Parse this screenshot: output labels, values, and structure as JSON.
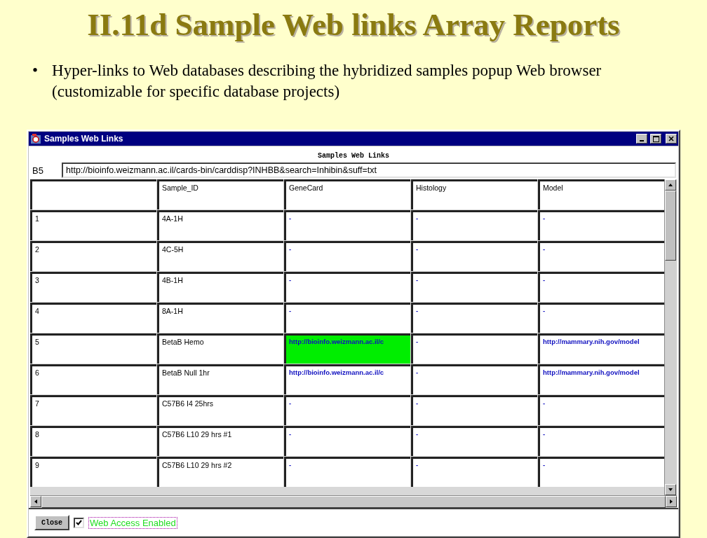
{
  "slide": {
    "title": "II.11d Sample Web links Array Reports",
    "bullets": [
      {
        "marker": "•",
        "text": "Hyper-links to Web databases describing the hybridized samples popup Web browser (customizable for specific database projects)"
      }
    ]
  },
  "window": {
    "title": "Samples Web Links",
    "caption": "Samples Web Links",
    "address": {
      "label": "B5",
      "value": "http://bioinfo.weizmann.ac.il/cards-bin/carddisp?INHBB&search=Inhibin&suff=txt"
    },
    "table": {
      "columns": [
        "",
        "Sample_ID",
        "GeneCard",
        "Histology",
        "Model"
      ],
      "rows": [
        {
          "cells": [
            {
              "kind": "plain",
              "text": "1",
              "selected": false
            },
            {
              "kind": "plain",
              "text": "4A-1H",
              "selected": false
            },
            {
              "kind": "link",
              "text": "-",
              "selected": false
            },
            {
              "kind": "link",
              "text": "-",
              "selected": false
            },
            {
              "kind": "link",
              "text": "-",
              "selected": false
            }
          ]
        },
        {
          "cells": [
            {
              "kind": "plain",
              "text": "2",
              "selected": false
            },
            {
              "kind": "plain",
              "text": "4C-5H",
              "selected": false
            },
            {
              "kind": "link",
              "text": "-",
              "selected": false
            },
            {
              "kind": "link",
              "text": "-",
              "selected": false
            },
            {
              "kind": "link",
              "text": "-",
              "selected": false
            }
          ]
        },
        {
          "cells": [
            {
              "kind": "plain",
              "text": "3",
              "selected": false
            },
            {
              "kind": "plain",
              "text": "4B-1H",
              "selected": false
            },
            {
              "kind": "link",
              "text": "-",
              "selected": false
            },
            {
              "kind": "link",
              "text": "-",
              "selected": false
            },
            {
              "kind": "link",
              "text": "-",
              "selected": false
            }
          ]
        },
        {
          "cells": [
            {
              "kind": "plain",
              "text": "4",
              "selected": false
            },
            {
              "kind": "plain",
              "text": "8A-1H",
              "selected": false
            },
            {
              "kind": "link",
              "text": "-",
              "selected": false
            },
            {
              "kind": "link",
              "text": "-",
              "selected": false
            },
            {
              "kind": "link",
              "text": "-",
              "selected": false
            }
          ]
        },
        {
          "cells": [
            {
              "kind": "plain",
              "text": "5",
              "selected": false
            },
            {
              "kind": "plain",
              "text": "BetaB Hemo",
              "selected": false
            },
            {
              "kind": "link",
              "text": "http://bioinfo.weizmann.ac.il/c",
              "selected": true
            },
            {
              "kind": "link",
              "text": "-",
              "selected": false
            },
            {
              "kind": "link",
              "text": "http://mammary.nih.gov/model",
              "selected": false
            }
          ]
        },
        {
          "cells": [
            {
              "kind": "plain",
              "text": "6",
              "selected": false
            },
            {
              "kind": "plain",
              "text": "BetaB Null 1hr",
              "selected": false
            },
            {
              "kind": "link",
              "text": "http://bioinfo.weizmann.ac.il/c",
              "selected": false
            },
            {
              "kind": "link",
              "text": "-",
              "selected": false
            },
            {
              "kind": "link",
              "text": "http://mammary.nih.gov/model",
              "selected": false
            }
          ]
        },
        {
          "cells": [
            {
              "kind": "plain",
              "text": "7",
              "selected": false
            },
            {
              "kind": "plain",
              "text": "C57B6 I4 25hrs",
              "selected": false
            },
            {
              "kind": "link",
              "text": "-",
              "selected": false
            },
            {
              "kind": "link",
              "text": "-",
              "selected": false
            },
            {
              "kind": "link",
              "text": "-",
              "selected": false
            }
          ]
        },
        {
          "cells": [
            {
              "kind": "plain",
              "text": "8",
              "selected": false
            },
            {
              "kind": "plain",
              "text": "C57B6 L10 29 hrs #1",
              "selected": false
            },
            {
              "kind": "link",
              "text": "-",
              "selected": false
            },
            {
              "kind": "link",
              "text": "-",
              "selected": false
            },
            {
              "kind": "link",
              "text": "-",
              "selected": false
            }
          ]
        },
        {
          "cells": [
            {
              "kind": "plain",
              "text": "9",
              "selected": false
            },
            {
              "kind": "plain",
              "text": "C57B6 L10 29 hrs #2",
              "selected": false
            },
            {
              "kind": "link",
              "text": "-",
              "selected": false
            },
            {
              "kind": "link",
              "text": "-",
              "selected": false
            },
            {
              "kind": "link",
              "text": "-",
              "selected": false
            }
          ]
        }
      ]
    },
    "close_button": "Close",
    "web_access": {
      "label": "Web Access Enabled",
      "checked": true
    }
  }
}
